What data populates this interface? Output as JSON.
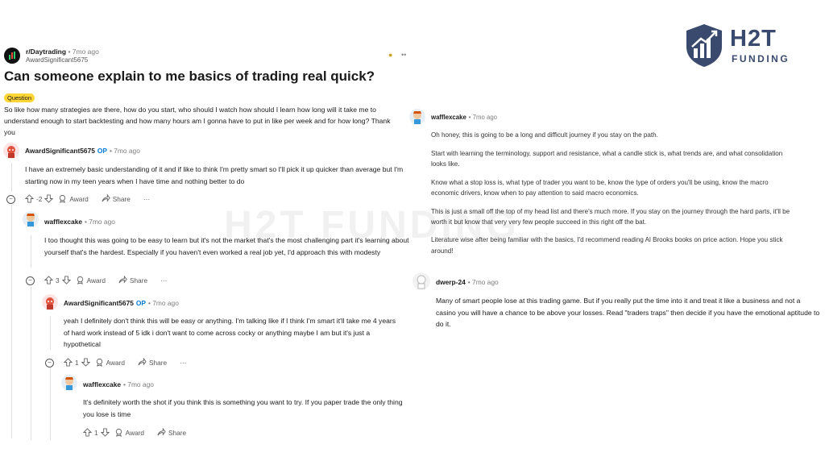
{
  "logo": {
    "line1": "H2T",
    "line2": "FUNDING"
  },
  "watermark": "H2T FUNDING",
  "post": {
    "subreddit": "r/Daytrading",
    "time": "• 7mo ago",
    "author": "AwardSignificant5675",
    "title": "Can someone explain to me basics of trading real quick?",
    "flair": "Question",
    "body": "So like how many strategies are there, how do you start, who should I watch how should I learn how long will it take me to understand enough to start backtesting and how many hours am I gonna have to put in like per week and for how long? Thank you"
  },
  "comments": [
    {
      "author": "AwardSignificant5675",
      "op": "OP",
      "time": "• 7mo ago",
      "text": "I have an extremely basic understanding of it and if like to think I'm pretty smart so I'll pick it up quicker than average but I'm starting now in my teen years when I have time and nothing better to do",
      "votes": "-2",
      "award": "Award",
      "share": "Share",
      "more": "···"
    },
    {
      "author": "wafflexcake",
      "time": "• 7mo ago",
      "text": "I too thought this was going to be easy to learn but it's not the market that's the most challenging part it's learning about yourself that's the hardest. Especially if you haven't even worked a real job yet, I'd approach this with modesty",
      "votes": "3",
      "award": "Award",
      "share": "Share",
      "more": "···"
    },
    {
      "author": "AwardSignificant5675",
      "op": "OP",
      "time": "• 7mo ago",
      "text": "yeah I definitely don't think this will be easy or anything. I'm talking like if I think I'm smart it'll take me 4 years of hard work instead of 5 idk i don't want to come across cocky or anything maybe I am but it's just a hypothetical",
      "votes": "1",
      "award": "Award",
      "share": "Share",
      "more": "···"
    },
    {
      "author": "wafflexcake",
      "time": "• 7mo ago",
      "text": "It's definitely worth the shot if you think this is something you want to try. If you paper trade the only thing you lose is time",
      "votes": "1",
      "award": "Award",
      "share": "Share"
    }
  ],
  "right_comments": [
    {
      "author": "wafflexcake",
      "time": "• 7mo ago",
      "paragraphs": [
        "Oh honey, this is going to be a long and difficult journey if you stay on the path.",
        "Start with learning the terminology, support and resistance, what a candle stick is, what trends are, and what consolidation looks like.",
        "Know what a stop loss is, what type of trader you want to be, know the type of orders you'll be using, know the macro economic drivers, know when to pay attention to said macro economics.",
        "This is just a small off the top of my head list and there's much more. If you stay on the journey through the hard parts, it'll be worth it but know that very very few people succeed in this right off the bat.",
        "Literature wise after being familiar with the basics, I'd recommend reading Al Brooks books on price action. Hope you stick around!"
      ]
    },
    {
      "author": "dwerp-24",
      "time": "• 7mo ago",
      "text": "Many of smart people lose at this trading game. But if you really put the time into it and treat it like a business and not a casino you will have a chance to be above your losses. Read \"traders traps\" then decide if you have the emotional aptitude to do it."
    }
  ],
  "colors": {
    "brand": "#3a4a6e",
    "op_blue": "#0079d3",
    "flair": "#ffd635"
  }
}
